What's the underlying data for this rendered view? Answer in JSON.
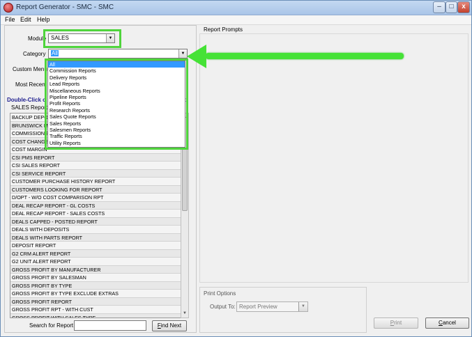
{
  "window": {
    "title": "Report Generator - SMC - SMC",
    "min_glyph": "–",
    "max_glyph": "□",
    "close_glyph": "x"
  },
  "menu": [
    "File",
    "Edit",
    "Help"
  ],
  "filters": {
    "module_label": "Module",
    "module_value": "SALES",
    "category_label": "Category",
    "category_value": "All",
    "custom_menu_label": "Custom Menu",
    "most_recent_label": "Most Recent"
  },
  "instruction": {
    "prefix": "Double-Click o",
    "suffix": "t."
  },
  "list_header": "SALES Reports",
  "reports": [
    "BACKUP DEPO",
    "BRUNSWICK M",
    "COMMISSIONS",
    "COST CHANGE",
    "COST MARGIN",
    "CSI PMS REPORT",
    "CSI SALES REPORT",
    "CSI SERVICE REPORT",
    "CUSTOMER PURCHASE HISTORY REPORT",
    "CUSTOMERS LOOKING FOR REPORT",
    "D/OPT - W/O COST COMPARISON RPT",
    "DEAL RECAP REPORT - GL COSTS",
    "DEAL RECAP REPORT - SALES COSTS",
    "DEALS CAPPED - POSTED REPORT",
    "DEALS WITH DEPOSITS",
    "DEALS WITH PARTS REPORT",
    "DEPOSIT REPORT",
    "G2 CRM ALERT REPORT",
    "G2 UNIT ALERT REPORT",
    "GROSS PROFIT BY MANUFACTURER",
    "GROSS PROFIT BY SALESMAN",
    "GROSS PROFIT BY TYPE",
    "GROSS PROFIT BY TYPE EXCLUDE EXTRAS",
    "GROSS PROFIT REPORT",
    "GROSS PROFIT RPT - WITH CUST",
    "GROSS PROFIT WITH SALES TYPE"
  ],
  "category_dropdown": [
    "All",
    "Commission Reports",
    "Delivery Reports",
    "Lead Reports",
    "Miscellaneous Reports",
    "Pipeline Reports",
    "Profit Reports",
    "Research Reports",
    "Sales Quote Reports",
    "Sales Reports",
    "Salesmen Reports",
    "Traffic Reports",
    "Utility Reports"
  ],
  "search": {
    "label": "Search for Report",
    "value": "",
    "find_first": "F",
    "find_rest": "ind Next"
  },
  "prompts_label": "Report Prompts",
  "print_options": {
    "label": "Print Options",
    "output_label": "Output To:",
    "output_value": "Report Preview"
  },
  "buttons": {
    "print_first": "P",
    "print_rest": "rint",
    "cancel_first": "C",
    "cancel_rest": "ancel"
  },
  "colors": {
    "highlight": "#45e236",
    "selection": "#3399ff"
  }
}
